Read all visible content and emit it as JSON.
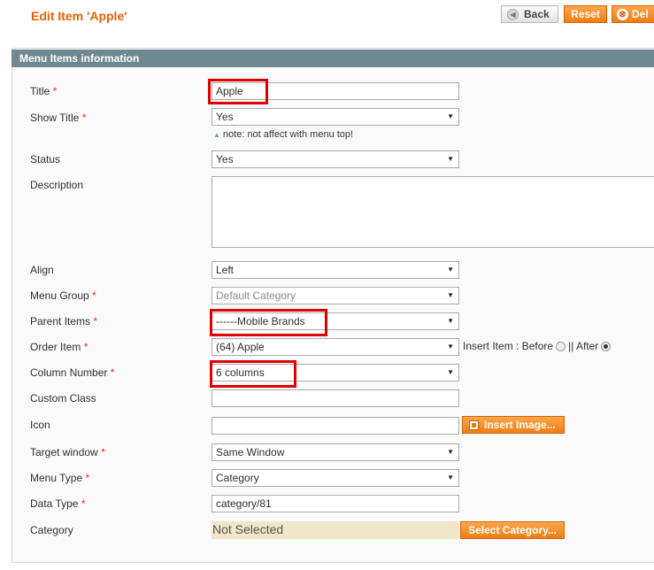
{
  "header": {
    "title": "Edit Item 'Apple'",
    "back_label": "Back",
    "reset_label": "Reset",
    "delete_label": "Del"
  },
  "section": {
    "title": "Menu Items information"
  },
  "fields": {
    "title": {
      "label": "Title",
      "value": "Apple"
    },
    "show_title": {
      "label": "Show Title",
      "value": "Yes",
      "note": "note: not affect with menu top!"
    },
    "status": {
      "label": "Status",
      "value": "Yes"
    },
    "description": {
      "label": "Description",
      "value": ""
    },
    "align": {
      "label": "Align",
      "value": "Left"
    },
    "menu_group": {
      "label": "Menu Group",
      "value": "Default Category"
    },
    "parent_items": {
      "label": "Parent Items",
      "value": "------Mobile Brands"
    },
    "order_item": {
      "label": "Order Item",
      "value": "(64) Apple",
      "insert_label": "Insert Item : Before",
      "after_label": "|| After"
    },
    "column_number": {
      "label": "Column Number",
      "value": "6 columns"
    },
    "custom_class": {
      "label": "Custom Class",
      "value": ""
    },
    "icon": {
      "label": "Icon",
      "value": "",
      "button_label": "Insert Image..."
    },
    "target_window": {
      "label": "Target window",
      "value": "Same Window"
    },
    "menu_type": {
      "label": "Menu Type",
      "value": "Category"
    },
    "data_type": {
      "label": "Data Type",
      "value": "category/81"
    },
    "category": {
      "label": "Category",
      "value": "Not Selected",
      "button_label": "Select Category..."
    }
  },
  "required_mark": "*",
  "colors": {
    "accent": "#eb5e00",
    "section_header": "#6f8992",
    "required": "#eb340a",
    "highlight": "#e00000"
  }
}
